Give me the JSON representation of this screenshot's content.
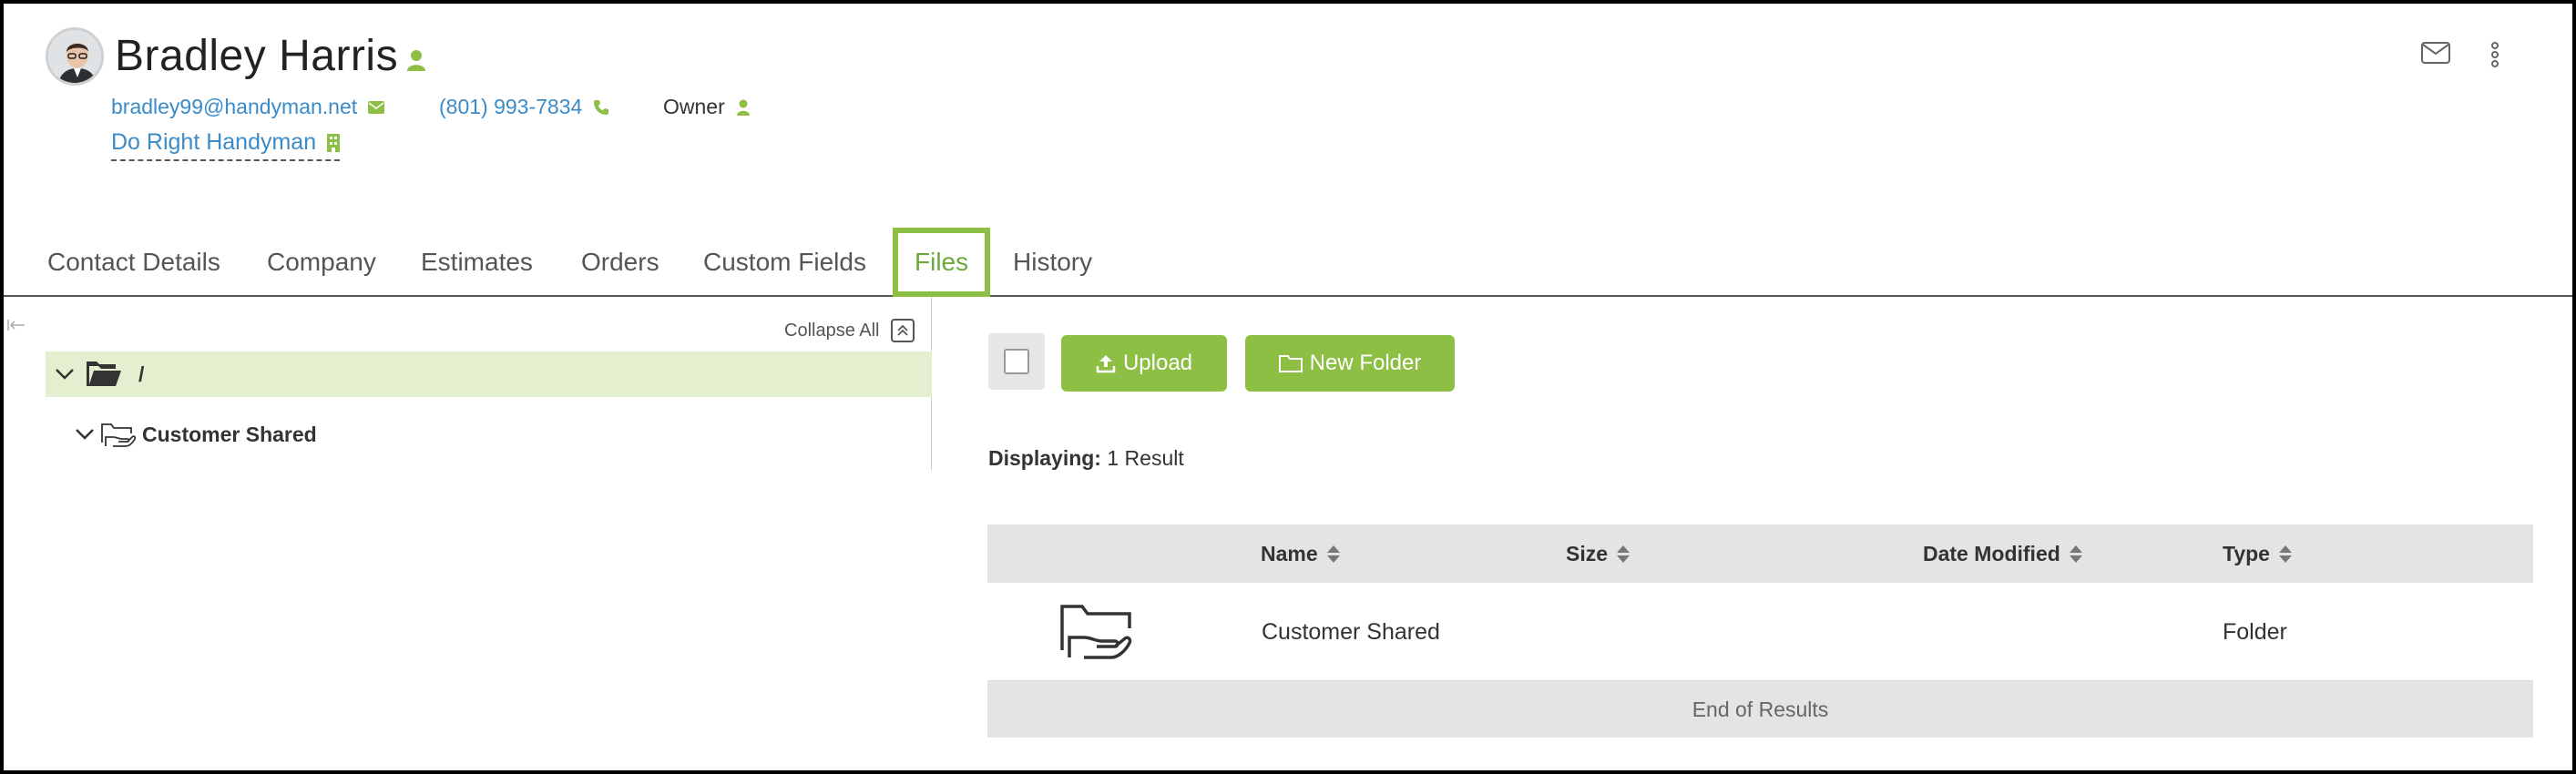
{
  "contact": {
    "name": "Bradley Harris",
    "email": "bradley99@handyman.net",
    "phone": "(801) 993-7834",
    "role": "Owner",
    "company": "Do Right Handyman"
  },
  "tabs": [
    {
      "label": "Contact Details"
    },
    {
      "label": "Company"
    },
    {
      "label": "Estimates"
    },
    {
      "label": "Orders"
    },
    {
      "label": "Custom Fields"
    },
    {
      "label": "Files",
      "active": true
    },
    {
      "label": "History"
    }
  ],
  "tree": {
    "collapse_all": "Collapse All",
    "root_label": "/",
    "child_label": "Customer Shared"
  },
  "toolbar": {
    "upload_label": "Upload",
    "new_folder_label": "New Folder"
  },
  "results": {
    "displaying_label": "Displaying:",
    "displaying_value": "1 Result",
    "footer": "End of Results"
  },
  "table": {
    "columns": [
      "Name",
      "Size",
      "Date Modified",
      "Type"
    ],
    "rows": [
      {
        "name": "Customer Shared",
        "size": "",
        "date_modified": "",
        "type": "Folder",
        "icon": "shared-folder-icon"
      }
    ]
  },
  "colors": {
    "accent": "#8dbf45",
    "link": "#3a8bc8",
    "tree_selected": "#e4efcf"
  }
}
